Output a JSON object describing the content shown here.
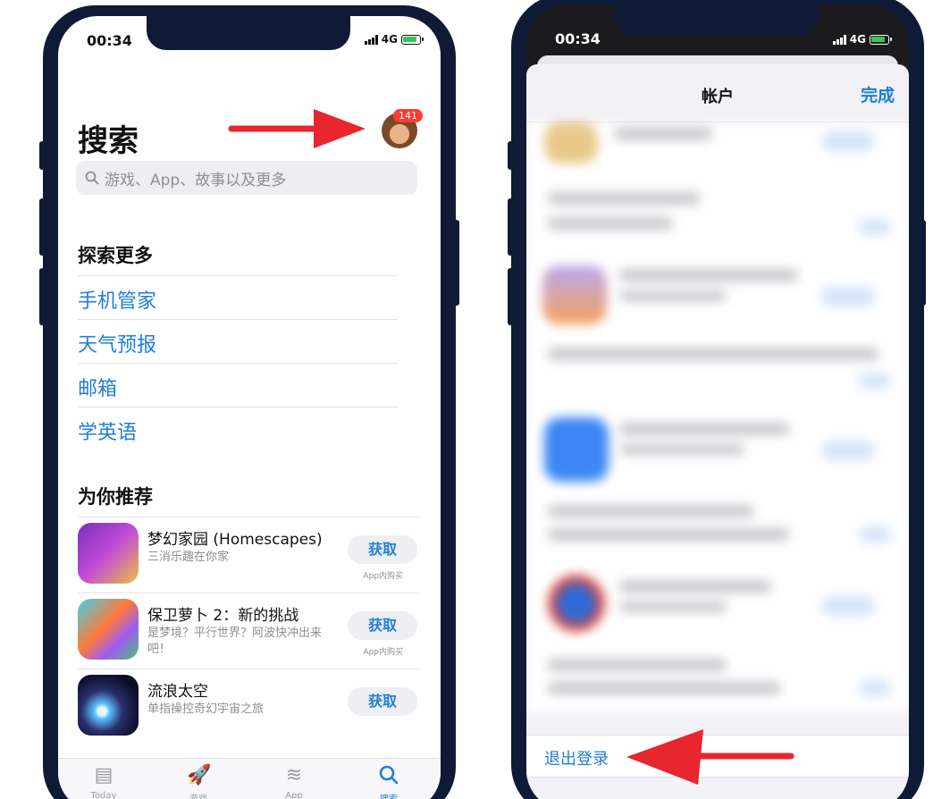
{
  "left_phone": {
    "status": {
      "time": "00:34",
      "network": "4G"
    },
    "title": "搜索",
    "badge_count": "141",
    "search": {
      "placeholder": "游戏、App、故事以及更多"
    },
    "explore": {
      "heading": "探索更多",
      "items": [
        "手机管家",
        "天气预报",
        "邮箱",
        "学英语"
      ]
    },
    "recommend": {
      "heading": "为你推荐",
      "apps": [
        {
          "name": "梦幻家园 (Homescapes)",
          "subtitle": "三消乐趣在你家",
          "button": "获取",
          "iap": "App内购买"
        },
        {
          "name": "保卫萝卜 2：新的挑战",
          "subtitle": "是梦境？平行世界？阿波快冲出来吧！",
          "button": "获取",
          "iap": "App内购买"
        },
        {
          "name": "流浪太空",
          "subtitle": "单指操控奇幻宇宙之旅",
          "button": "获取",
          "iap": ""
        }
      ]
    },
    "tabs": [
      {
        "label": "Today",
        "icon": "today-icon"
      },
      {
        "label": "游戏",
        "icon": "rocket-icon"
      },
      {
        "label": "App",
        "icon": "layers-icon"
      },
      {
        "label": "搜索",
        "icon": "search-icon"
      }
    ]
  },
  "right_phone": {
    "status": {
      "time": "00:34",
      "network": "4G"
    },
    "nav": {
      "title": "帐户",
      "done": "完成"
    },
    "sign_out": "退出登录"
  },
  "colors": {
    "accent": "#1e7fd8",
    "badge": "#ff3b30",
    "arrow": "#e8262e",
    "bezel": "#0f1a36"
  }
}
